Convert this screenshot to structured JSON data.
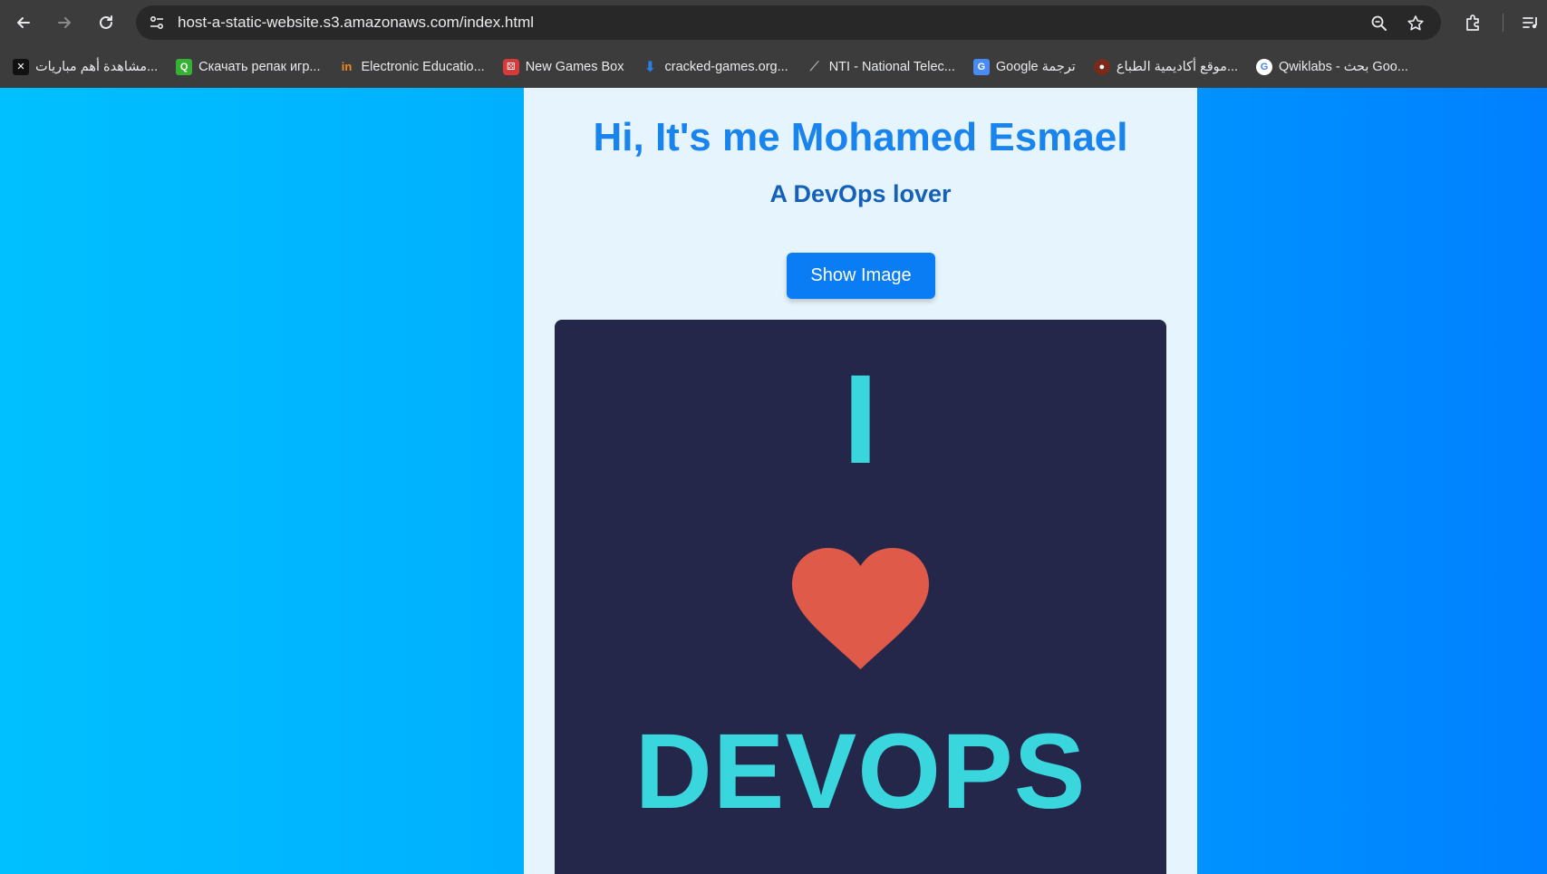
{
  "browser": {
    "url": "host-a-static-website.s3.amazonaws.com/index.html",
    "bookmarks": [
      {
        "label": "مشاهدة أهم مباريات...",
        "icon": "ai-site-icon",
        "color": "#111111"
      },
      {
        "label": "Скачать репак игр...",
        "icon": "green-q-icon",
        "color": "#35b234"
      },
      {
        "label": "Electronic Educatio...",
        "icon": "in-logo-icon",
        "color": "#f08a24"
      },
      {
        "label": "New Games Box",
        "icon": "dice-icon",
        "color": "#d83a3a"
      },
      {
        "label": "cracked-games.org...",
        "icon": "download-arrow-icon",
        "color": "#2a7de1"
      },
      {
        "label": "NTI - National Telec...",
        "icon": "nti-logo-icon",
        "color": "#8a8a8a"
      },
      {
        "label": "Google ترجمة",
        "icon": "google-translate-icon",
        "color": "#4a8af4"
      },
      {
        "label": "موقع أكاديمية الطباع...",
        "icon": "academy-icon",
        "color": "#7a2a1a"
      },
      {
        "label": "Qwiklabs - بحث Goo...",
        "icon": "google-icon",
        "color": "#ffffff"
      }
    ]
  },
  "page": {
    "title": "Hi, It's me Mohamed Esmael",
    "subtitle": "A DevOps lover",
    "show_button_label": "Show Image",
    "image": {
      "top_text": "I",
      "bottom_text": "DEVOPS",
      "heart_color": "#e05a4a",
      "text_color": "#3ad6de",
      "background": "#25274a"
    }
  },
  "colors": {
    "title": "#1a84ee",
    "subtitle": "#1560b8",
    "button": "#0a7cf4",
    "card_bg": "#e6f5fd"
  }
}
